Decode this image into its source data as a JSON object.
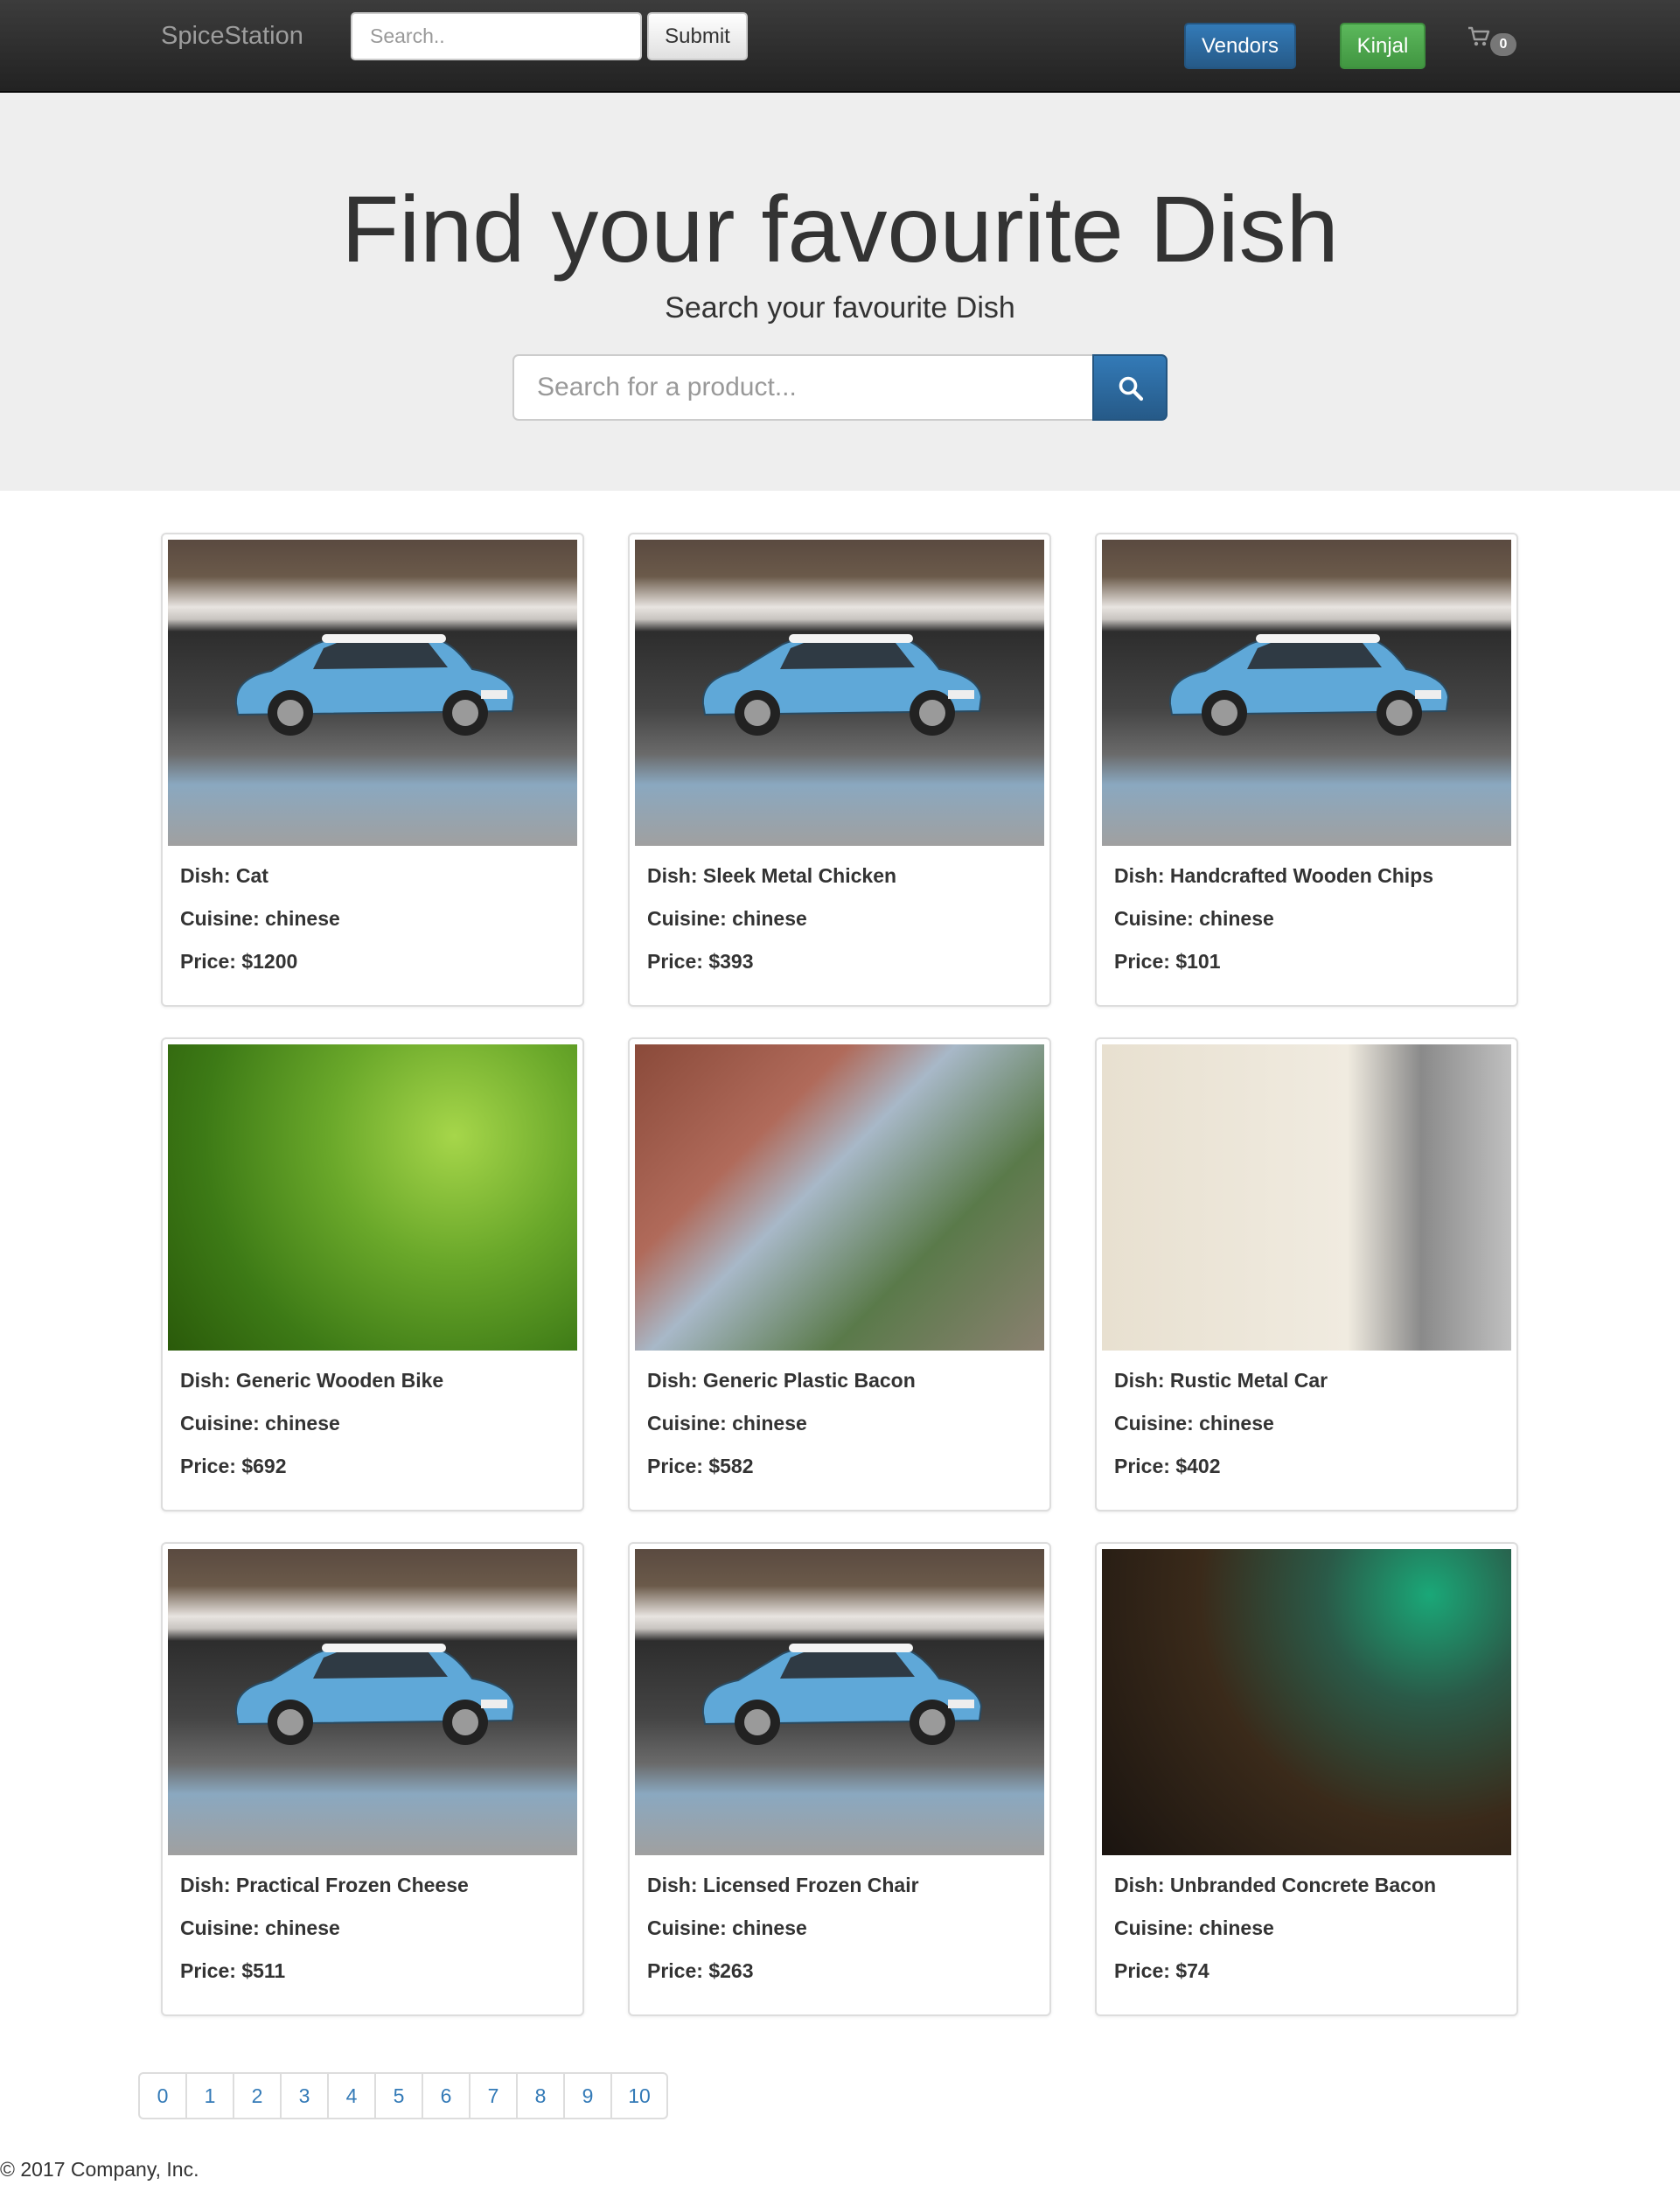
{
  "navbar": {
    "brand": "SpiceStation",
    "search_placeholder": "Search..",
    "submit_label": "Submit",
    "vendors_label": "Vendors",
    "user_label": "Kinjal",
    "cart_count": "0",
    "cart_icon": "shopping-cart-icon"
  },
  "hero": {
    "title": "Find your favourite Dish",
    "subtitle": "Search your favourite Dish",
    "search_placeholder": "Search for a product...",
    "search_icon": "search-icon"
  },
  "products": [
    {
      "dish": "Dish: Cat",
      "cuisine": "Cuisine: chinese",
      "price": "Price: $1200",
      "image": "blue-car"
    },
    {
      "dish": "Dish: Sleek Metal Chicken",
      "cuisine": "Cuisine: chinese",
      "price": "Price: $393",
      "image": "blue-car"
    },
    {
      "dish": "Dish: Handcrafted Wooden Chips",
      "cuisine": "Cuisine: chinese",
      "price": "Price: $101",
      "image": "blue-car"
    },
    {
      "dish": "Dish: Generic Wooden Bike",
      "cuisine": "Cuisine: chinese",
      "price": "Price: $692",
      "image": "ants-on-grass"
    },
    {
      "dish": "Dish: Generic Plastic Bacon",
      "cuisine": "Cuisine: chinese",
      "price": "Price: $582",
      "image": "cat-on-fence"
    },
    {
      "dish": "Dish: Rustic Metal Car",
      "cuisine": "Cuisine: chinese",
      "price": "Price: $402",
      "image": "office-meeting"
    },
    {
      "dish": "Dish: Practical Frozen Cheese",
      "cuisine": "Cuisine: chinese",
      "price": "Price: $511",
      "image": "blue-car"
    },
    {
      "dish": "Dish: Licensed Frozen Chair",
      "cuisine": "Cuisine: chinese",
      "price": "Price: $263",
      "image": "blue-car"
    },
    {
      "dish": "Dish: Unbranded Concrete Bacon",
      "cuisine": "Cuisine: chinese",
      "price": "Price: $74",
      "image": "circuit-board"
    }
  ],
  "pagination": [
    "0",
    "1",
    "2",
    "3",
    "4",
    "5",
    "6",
    "7",
    "8",
    "9",
    "10"
  ],
  "footer": "© 2017 Company, Inc.",
  "colors": {
    "navbar": "#222222",
    "primary": "#337ab7",
    "success": "#5cb85c",
    "jumbotron": "#eeeeee"
  }
}
